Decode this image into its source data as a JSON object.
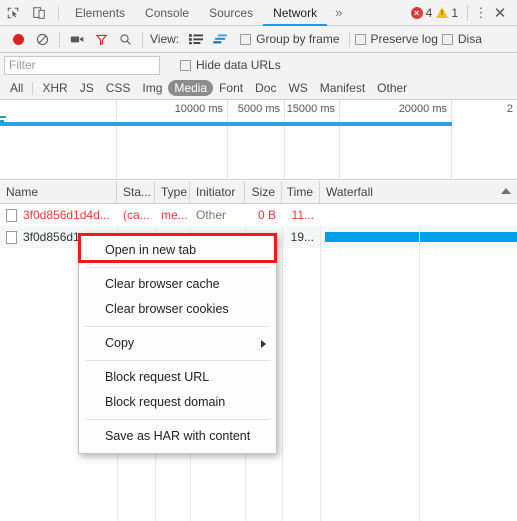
{
  "tabbar": {
    "inspect_icon": "inspect-element-icon",
    "device_icon": "device-toolbar-icon",
    "tabs": [
      {
        "label": "Elements",
        "active": false
      },
      {
        "label": "Console",
        "active": false
      },
      {
        "label": "Sources",
        "active": false
      },
      {
        "label": "Network",
        "active": true
      }
    ],
    "more_tabs": "»",
    "error_count": "4",
    "warning_count": "1",
    "menu_icon": "vertical-dots-icon",
    "close_icon": "close-icon"
  },
  "toolbar": {
    "record_icon": "record-button",
    "clear_icon": "clear-icon",
    "capture_screenshots_icon": "camera-icon",
    "filter_icon": "funnel-icon",
    "search_icon": "search-icon",
    "view_label": "View:",
    "list_view_icon": "list-view-icon",
    "waterfall_view_icon": "waterfall-view-icon",
    "group_by_frame": "Group by frame",
    "preserve_log": "Preserve log",
    "disable_cache": "Disa"
  },
  "filter": {
    "placeholder": "Filter",
    "value": "",
    "hide_data_urls": "Hide data URLs",
    "types": [
      {
        "label": "All",
        "active": false
      },
      {
        "label": "XHR",
        "active": false
      },
      {
        "label": "JS",
        "active": false
      },
      {
        "label": "CSS",
        "active": false
      },
      {
        "label": "Img",
        "active": false
      },
      {
        "label": "Media",
        "active": true
      },
      {
        "label": "Font",
        "active": false
      },
      {
        "label": "Doc",
        "active": false
      },
      {
        "label": "WS",
        "active": false
      },
      {
        "label": "Manifest",
        "active": false
      },
      {
        "label": "Other",
        "active": false
      }
    ]
  },
  "overview": {
    "ticks": [
      "5000 ms",
      "10000 ms",
      "15000 ms",
      "20000 ms",
      "2"
    ]
  },
  "table": {
    "columns": [
      "Name",
      "Sta...",
      "Type",
      "Initiator",
      "Size",
      "Time",
      "Waterfall"
    ],
    "sort_indicator": "ascending",
    "rows": [
      {
        "name": "3f0d856d1d4d...",
        "status": "(ca...",
        "type": "me...",
        "initiator": "Other",
        "size": "0 B",
        "time": "11...",
        "failed": true,
        "waterfall": false
      },
      {
        "name": "3f0d856d1",
        "status": "",
        "type": "",
        "initiator": "",
        "size": "",
        "time": "19...",
        "failed": false,
        "waterfall": true
      }
    ]
  },
  "context_menu": {
    "items": [
      {
        "label": "Open in new tab",
        "highlighted": true,
        "submenu": false,
        "separator_after": true
      },
      {
        "label": "Clear browser cache",
        "highlighted": false,
        "submenu": false,
        "separator_after": false
      },
      {
        "label": "Clear browser cookies",
        "highlighted": false,
        "submenu": false,
        "separator_after": true
      },
      {
        "label": "Copy",
        "highlighted": false,
        "submenu": true,
        "separator_after": true
      },
      {
        "label": "Block request URL",
        "highlighted": false,
        "submenu": false,
        "separator_after": false
      },
      {
        "label": "Block request domain",
        "highlighted": false,
        "submenu": false,
        "separator_after": true
      },
      {
        "label": "Save as HAR with content",
        "highlighted": false,
        "submenu": false,
        "separator_after": false
      }
    ],
    "highlight_color": "#ef1b1b"
  }
}
